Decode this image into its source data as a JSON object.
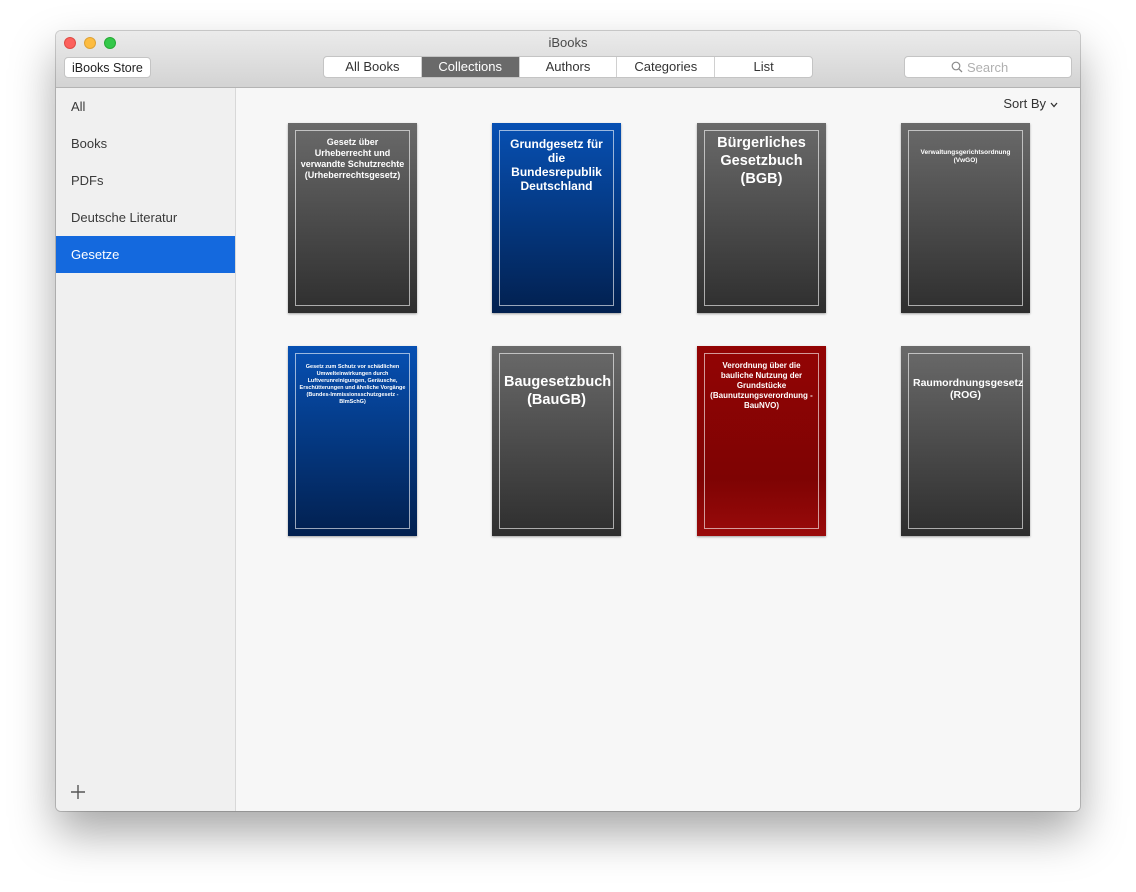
{
  "window": {
    "title": "iBooks"
  },
  "toolbar": {
    "store_label": "iBooks Store",
    "tabs": [
      {
        "label": "All Books",
        "active": false
      },
      {
        "label": "Collections",
        "active": true
      },
      {
        "label": "Authors",
        "active": false
      },
      {
        "label": "Categories",
        "active": false
      },
      {
        "label": "List",
        "active": false
      }
    ],
    "search_placeholder": "Search"
  },
  "sidebar": {
    "items": [
      {
        "label": "All"
      },
      {
        "label": "Books"
      },
      {
        "label": "PDFs"
      },
      {
        "label": "Deutsche Literatur"
      },
      {
        "label": "Gesetze",
        "selected": true
      }
    ],
    "add_icon": "plus-icon"
  },
  "content": {
    "sort_label": "Sort By",
    "books": [
      {
        "title": "Gesetz über Urheberrecht und verwandte Schutzrechte (Urheberrechtsgesetz)",
        "color": "gray"
      },
      {
        "title": "Grundgesetz für die Bundesrepublik Deutschland",
        "color": "blue"
      },
      {
        "title": "Bürgerliches Gesetzbuch (BGB)",
        "color": "gray"
      },
      {
        "title": "Verwaltungsgerichtsordnung (VwGO)",
        "color": "gray"
      },
      {
        "title": "Gesetz zum Schutz vor schädlichen Umwelteinwirkungen durch Luftverunreinigungen, Geräusche, Erschütterungen und ähnliche Vorgänge (Bundes-Immissionsschutzgesetz - BImSchG)",
        "color": "blue"
      },
      {
        "title": "Baugesetzbuch (BauGB)",
        "color": "gray"
      },
      {
        "title": "Verordnung über die bauliche Nutzung der Grundstücke (Baunutzungsverordnung - BauNVO)",
        "color": "red"
      },
      {
        "title": "Raumordnungsgesetz (ROG)",
        "color": "gray"
      }
    ]
  },
  "colors": {
    "selection": "#1469de",
    "active_tab": "#6a6a6a",
    "book_gray": "#4a4a4a",
    "book_blue": "#053a8a",
    "book_red": "#8a0303"
  }
}
